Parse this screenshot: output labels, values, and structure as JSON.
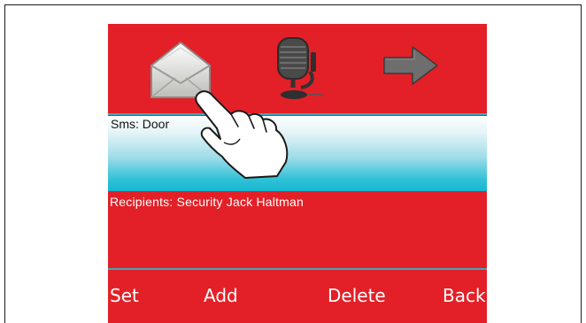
{
  "toolbar": {
    "icons": [
      "envelope-icon",
      "microphone-icon",
      "arrow-right-icon"
    ]
  },
  "message": {
    "text": "Sms: Door"
  },
  "recipients": {
    "text": "Recipients: Security Jack Haltman"
  },
  "softkeys": {
    "set": "Set",
    "add": "Add",
    "delete": "Delete",
    "back": "Back"
  },
  "colors": {
    "screen_background": "#e32027",
    "divider": "#40a6bd",
    "field_gradient_bottom": "#16b8cf",
    "text_light": "#ffffff",
    "text_dark": "#111111"
  }
}
